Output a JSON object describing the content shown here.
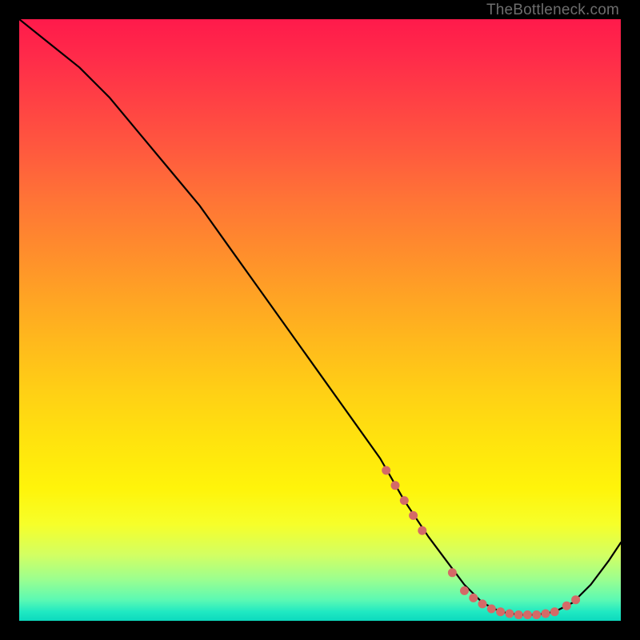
{
  "watermark": "TheBottleneck.com",
  "chart_data": {
    "type": "line",
    "title": "",
    "xlabel": "",
    "ylabel": "",
    "xlim": [
      0,
      100
    ],
    "ylim": [
      0,
      100
    ],
    "series": [
      {
        "name": "bottleneck-curve",
        "x": [
          0,
          5,
          10,
          15,
          20,
          25,
          30,
          35,
          40,
          45,
          50,
          55,
          60,
          64,
          68,
          71,
          74,
          77,
          80,
          83,
          86,
          89,
          92,
          95,
          98,
          100
        ],
        "values": [
          100,
          96,
          92,
          87,
          81,
          75,
          69,
          62,
          55,
          48,
          41,
          34,
          27,
          20,
          14,
          10,
          6,
          3,
          1.5,
          1,
          1,
          1.5,
          3,
          6,
          10,
          13
        ]
      }
    ],
    "markers": {
      "name": "highlight-dots",
      "x": [
        61,
        62.5,
        64,
        65.5,
        67,
        72,
        74,
        75.5,
        77,
        78.5,
        80,
        81.5,
        83,
        84.5,
        86,
        87.5,
        89,
        91,
        92.5
      ],
      "values": [
        25,
        22.5,
        20,
        17.5,
        15,
        8,
        5,
        3.8,
        2.8,
        2,
        1.5,
        1.2,
        1,
        1,
        1,
        1.2,
        1.5,
        2.5,
        3.5
      ]
    },
    "gradient_stops": [
      {
        "pos": 0,
        "color": "#ff1a4b"
      },
      {
        "pos": 0.5,
        "color": "#ffba1c"
      },
      {
        "pos": 0.8,
        "color": "#fff40a"
      },
      {
        "pos": 1.0,
        "color": "#0cd9be"
      }
    ]
  }
}
